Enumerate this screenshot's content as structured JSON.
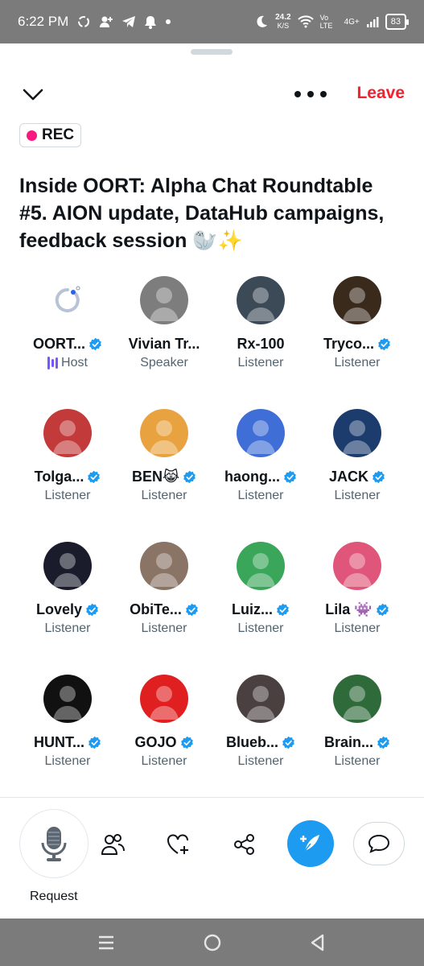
{
  "status_bar": {
    "time": "6:22 PM",
    "net_speed": "24.2",
    "net_unit": "K/S",
    "volte": "Vo LTE",
    "signal": "4G+",
    "battery": "83"
  },
  "header": {
    "leave_label": "Leave",
    "rec_label": "REC"
  },
  "space": {
    "title": "Inside OORT: Alpha Chat Roundtable #5. AION update, DataHub campaigns, feedback session 🦭✨"
  },
  "participants": [
    {
      "name": "OORT...",
      "role": "Host",
      "verified": true,
      "color": "#ffffff"
    },
    {
      "name": "Vivian Tr...",
      "role": "Speaker",
      "verified": false,
      "color": "#7d7d7d"
    },
    {
      "name": "Rx-100",
      "role": "Listener",
      "verified": false,
      "color": "#3c4a58"
    },
    {
      "name": "Tryco...",
      "role": "Listener",
      "verified": true,
      "color": "#3a2a1c"
    },
    {
      "name": "Tolga...",
      "role": "Listener",
      "verified": true,
      "color": "#c23a3a"
    },
    {
      "name": "BEN😹",
      "role": "Listener",
      "verified": true,
      "color": "#e8a340"
    },
    {
      "name": "haong...",
      "role": "Listener",
      "verified": true,
      "color": "#3f6fd6"
    },
    {
      "name": "JACK",
      "role": "Listener",
      "verified": true,
      "color": "#1d3c6e"
    },
    {
      "name": "Lovely",
      "role": "Listener",
      "verified": true,
      "color": "#1a1c2c"
    },
    {
      "name": "ObiTe...",
      "role": "Listener",
      "verified": true,
      "color": "#8a7466"
    },
    {
      "name": "Luiz...",
      "role": "Listener",
      "verified": true,
      "color": "#3aa65a"
    },
    {
      "name": "Lila 👾",
      "role": "Listener",
      "verified": true,
      "color": "#e0567a"
    },
    {
      "name": "HUNT...",
      "role": "Listener",
      "verified": true,
      "color": "#111111"
    },
    {
      "name": "GOJO",
      "role": "Listener",
      "verified": true,
      "color": "#e02020"
    },
    {
      "name": "Blueb...",
      "role": "Listener",
      "verified": true,
      "color": "#4a4040"
    },
    {
      "name": "Brain...",
      "role": "Listener",
      "verified": true,
      "color": "#2f6b3a"
    }
  ],
  "controls": {
    "request_label": "Request"
  },
  "colors": {
    "accent": "#1d9bf0",
    "leave": "#f4212e",
    "rec_dot": "#f91880",
    "host": "#7856ff"
  }
}
